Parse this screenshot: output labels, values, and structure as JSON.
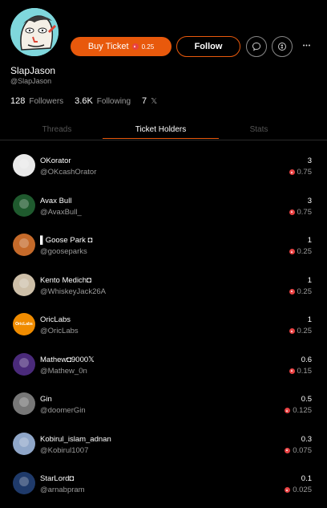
{
  "profile": {
    "name": "SlapJason",
    "handle": "@SlapJason",
    "followers_count": "128",
    "followers_label": "Followers",
    "following_count": "3.6K",
    "following_label": "Following",
    "x_count": "7",
    "x_glyph": "𝕏"
  },
  "actions": {
    "buy_label": "Buy Ticket",
    "buy_price": "0.25",
    "follow_label": "Follow",
    "more_glyph": "•••"
  },
  "tabs": [
    {
      "label": "Threads",
      "active": false
    },
    {
      "label": "Ticket Holders",
      "active": true
    },
    {
      "label": "Stats",
      "active": false
    }
  ],
  "holders": [
    {
      "name": "OKorator",
      "handle": "@OKcashOrator",
      "qty": "3",
      "value": "0.75",
      "avatar_color": "#e9e9e9"
    },
    {
      "name": "Avax Bull",
      "handle": "@AvaxBull_",
      "qty": "3",
      "value": "0.75",
      "avatar_color": "#1f5a2e"
    },
    {
      "name": "▌Goose Park ◘",
      "handle": "@gooseparks",
      "qty": "1",
      "value": "0.25",
      "avatar_color": "#c56a2a"
    },
    {
      "name": "Kento Medich◘",
      "handle": "@WhiskeyJack26A",
      "qty": "1",
      "value": "0.25",
      "avatar_color": "#cdbfa8"
    },
    {
      "name": "OricLabs",
      "handle": "@OricLabs",
      "qty": "1",
      "value": "0.25",
      "avatar_color": "#f08c00",
      "avatar_text": "OricLabs"
    },
    {
      "name": "Mathew◘9000𝕏",
      "handle": "@Mathew_0n",
      "qty": "0.6",
      "value": "0.15",
      "avatar_color": "#4a2a7a"
    },
    {
      "name": "Gin",
      "handle": "@doomerGin",
      "qty": "0.5",
      "value": "0.125",
      "avatar_color": "#777777"
    },
    {
      "name": "Kobirul_islam_adnan",
      "handle": "@Kobirul1007",
      "qty": "0.3",
      "value": "0.075",
      "avatar_color": "#8fa6c8"
    },
    {
      "name": "StarLord◘",
      "handle": "@arnabpram",
      "qty": "0.1",
      "value": "0.025",
      "avatar_color": "#1f3a6a"
    }
  ],
  "colors": {
    "accent": "#e8590c",
    "avax": "#e84142",
    "background": "#000000",
    "muted_text": "#9a9a9a"
  }
}
